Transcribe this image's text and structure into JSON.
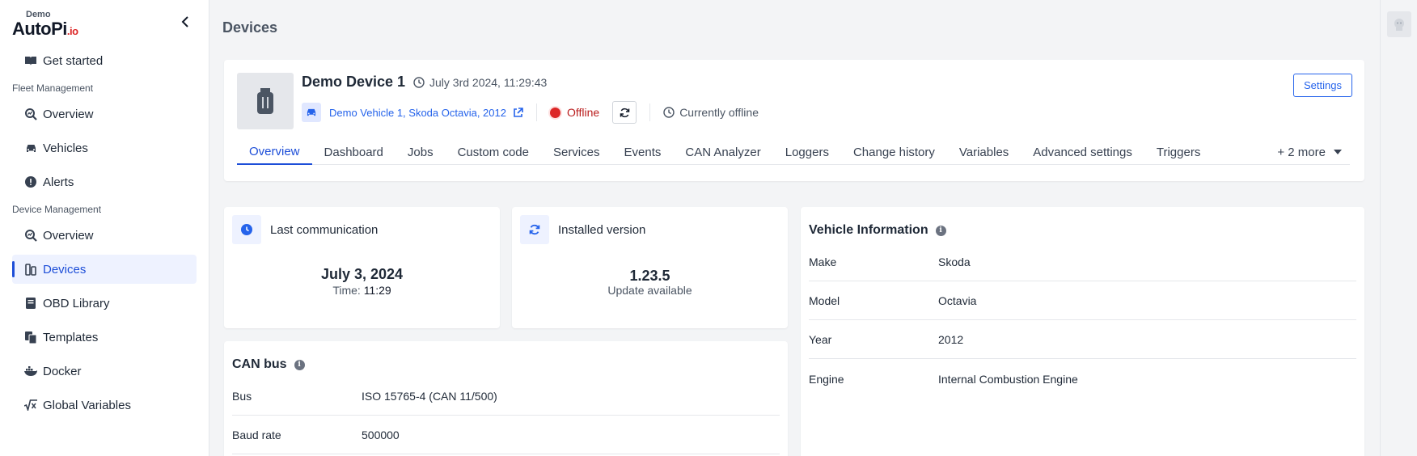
{
  "sidebar": {
    "logo_demo": "Demo",
    "logo_brand": "AutoPi",
    "logo_suffix": ".io",
    "sections": {
      "fleet": "Fleet Management",
      "device": "Device Management"
    },
    "items": {
      "get_started": "Get started",
      "fleet_overview": "Overview",
      "vehicles": "Vehicles",
      "alerts": "Alerts",
      "device_overview": "Overview",
      "devices": "Devices",
      "obd_library": "OBD Library",
      "templates": "Templates",
      "docker": "Docker",
      "global_variables": "Global Variables"
    }
  },
  "page": {
    "title": "Devices"
  },
  "device": {
    "name": "Demo Device 1",
    "timestamp": "July 3rd 2024, 11:29:43",
    "vehicle_link": "Demo Vehicle 1, Skoda Octavia, 2012",
    "status": "Offline",
    "status_detail": "Currently offline",
    "settings_label": "Settings",
    "status_color": "#dc2626"
  },
  "tabs": [
    {
      "label": "Overview"
    },
    {
      "label": "Dashboard"
    },
    {
      "label": "Jobs"
    },
    {
      "label": "Custom code"
    },
    {
      "label": "Services"
    },
    {
      "label": "Events"
    },
    {
      "label": "CAN Analyzer"
    },
    {
      "label": "Loggers"
    },
    {
      "label": "Change history"
    },
    {
      "label": "Variables"
    },
    {
      "label": "Advanced settings"
    },
    {
      "label": "Triggers"
    }
  ],
  "tabs_more": "+ 2 more",
  "last_communication": {
    "label": "Last communication",
    "date": "July 3, 2024",
    "time_label": "Time:",
    "time": "11:29"
  },
  "installed_version": {
    "label": "Installed version",
    "version": "1.23.5",
    "note": "Update available"
  },
  "can_bus": {
    "title": "CAN bus",
    "rows": [
      {
        "key": "Bus",
        "value": "ISO 15765-4 (CAN 11/500)"
      },
      {
        "key": "Baud rate",
        "value": "500000"
      }
    ]
  },
  "vehicle_info": {
    "title": "Vehicle Information",
    "rows": [
      {
        "key": "Make",
        "value": "Skoda"
      },
      {
        "key": "Model",
        "value": "Octavia"
      },
      {
        "key": "Year",
        "value": "2012"
      },
      {
        "key": "Engine",
        "value": "Internal Combustion Engine"
      }
    ]
  },
  "accent_color": "#1d4ed8"
}
